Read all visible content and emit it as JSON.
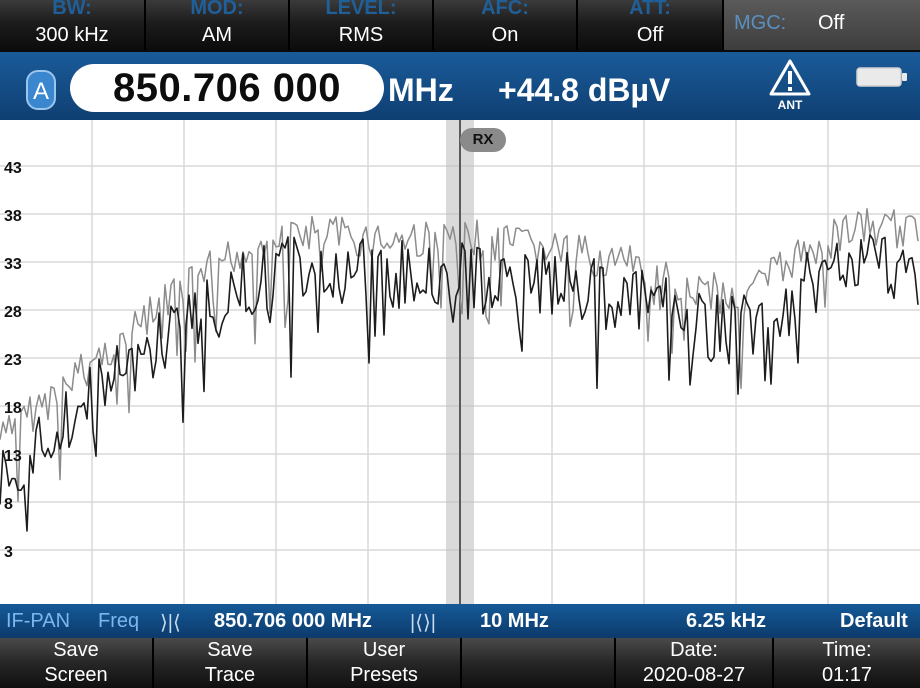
{
  "top_softkeys": [
    {
      "title": "BW:",
      "value": "300 kHz"
    },
    {
      "title": "MOD:",
      "value": "AM"
    },
    {
      "title": "LEVEL:",
      "value": "RMS"
    },
    {
      "title": "AFC:",
      "value": "On"
    },
    {
      "title": "ATT:",
      "value": "Off"
    }
  ],
  "mgc": {
    "label": "MGC:",
    "value": "Off"
  },
  "freq_bar": {
    "channel": "A",
    "frequency": "850.706 000",
    "unit": "MHz",
    "level": "+44.8 dBµV",
    "ant_label": "ANT"
  },
  "plot": {
    "y_ticks": [
      "43",
      "38",
      "33",
      "28",
      "23",
      "18",
      "13",
      "8",
      "3"
    ],
    "marker_label": "RX"
  },
  "status_bar": {
    "mode": "IF-PAN",
    "freq_label": "Freq",
    "center": "850.706 000 MHz",
    "span": "10 MHz",
    "step": "6.25 kHz",
    "preset": "Default",
    "icon_left": "⟩|⟨",
    "icon_right": "|⟨⟩|"
  },
  "bottom_softkeys": [
    {
      "l1": "Save",
      "l2": "Screen"
    },
    {
      "l1": "Save",
      "l2": "Trace"
    },
    {
      "l1": "User",
      "l2": "Presets"
    },
    {
      "l1": "",
      "l2": ""
    },
    {
      "l1": "Date:",
      "l2": "2020-08-27"
    },
    {
      "l1": "Time:",
      "l2": "01:17"
    }
  ],
  "colors": {
    "accent": "#1a5b9a",
    "trace_dark": "#1c1c1c",
    "trace_light": "#8c8c8c"
  }
}
